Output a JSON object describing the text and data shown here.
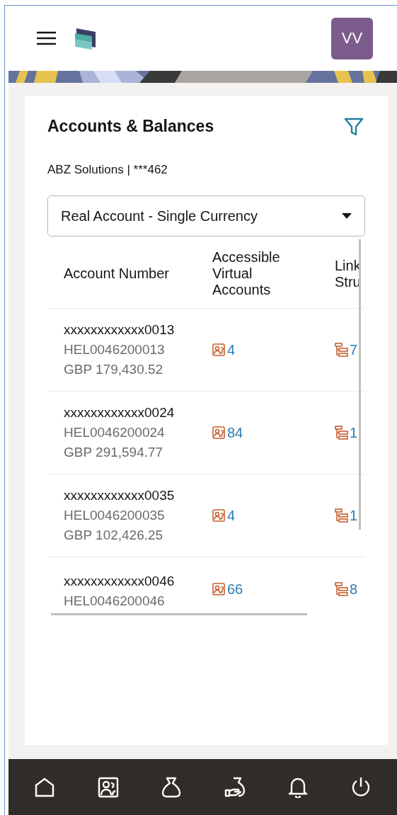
{
  "header": {
    "avatar_initials": "VV"
  },
  "page": {
    "title": "Accounts & Balances",
    "subtitle": "ABZ Solutions | ***462",
    "account_type": {
      "value": "Real Account - Single Currency"
    }
  },
  "table": {
    "columns": [
      "Account Number",
      "Accessible Virtual Accounts",
      "Link Stru"
    ],
    "rows": [
      {
        "account_number": "xxxxxxxxxxxx0013",
        "account_id": "HEL0046200013",
        "balance": "GBP 179,430.52",
        "virtual_accounts": "4",
        "column_3": "7"
      },
      {
        "account_number": "xxxxxxxxxxxx0024",
        "account_id": "HEL0046200024",
        "balance": "GBP 291,594.77",
        "virtual_accounts": "84",
        "column_3": "1"
      },
      {
        "account_number": "xxxxxxxxxxxx0035",
        "account_id": "HEL0046200035",
        "balance": "GBP 102,426.25",
        "virtual_accounts": "4",
        "column_3": "1"
      },
      {
        "account_number": "xxxxxxxxxxxx0046",
        "account_id": "HEL0046200046",
        "virtual_accounts": "66",
        "column_3": "8"
      }
    ]
  }
}
